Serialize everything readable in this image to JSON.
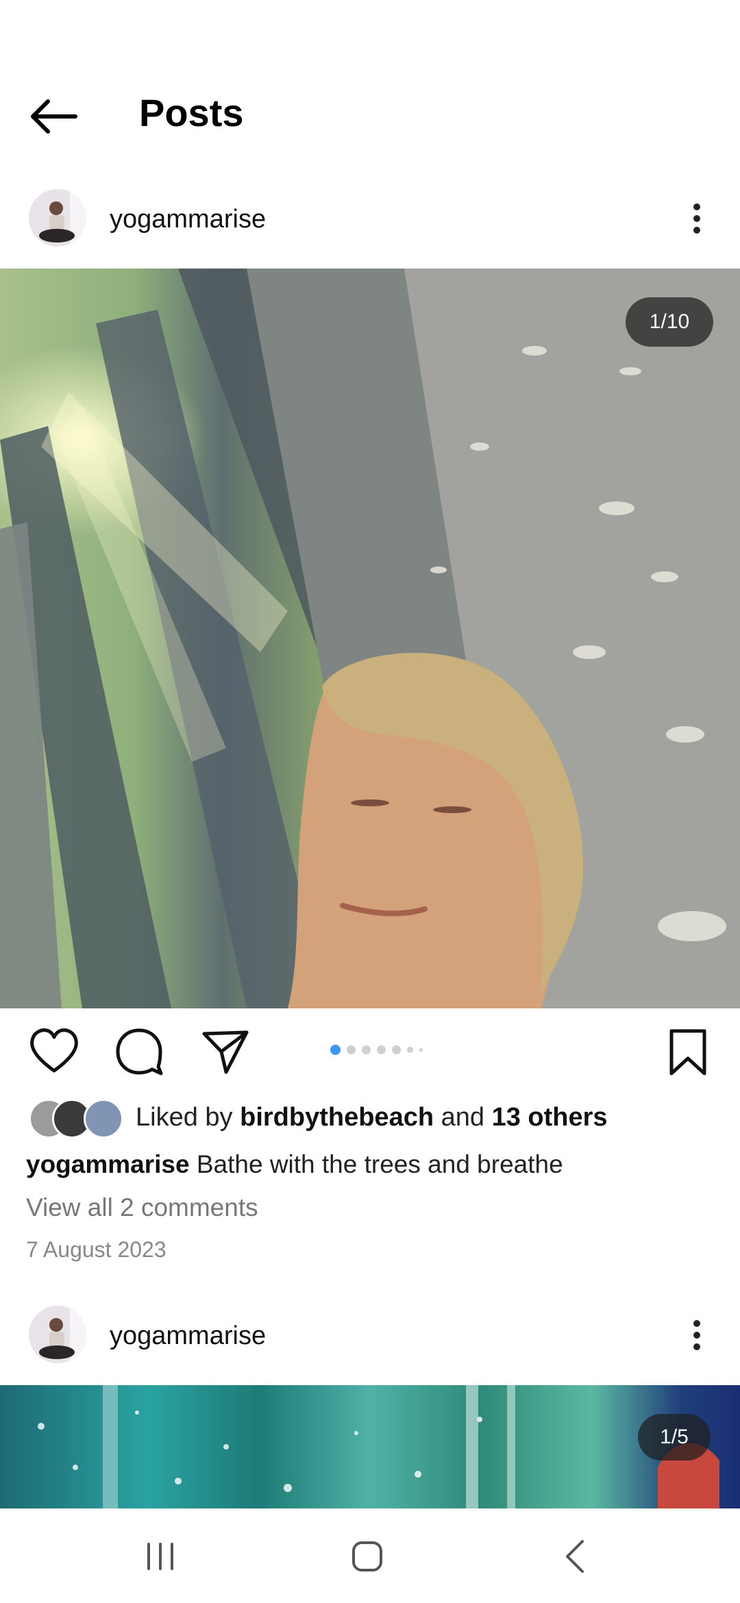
{
  "header": {
    "title": "Posts"
  },
  "posts": [
    {
      "username": "yogammarise",
      "counter": "1/10",
      "liked_by_prefix": "Liked by",
      "liked_by_user": "birdbythebeach",
      "liked_by_and": "and",
      "liked_by_others": "13 others",
      "caption_user": "yogammarise",
      "caption_text": " Bathe with the trees and breathe",
      "view_comments": "View all 2 comments",
      "date": "7 August 2023",
      "carousel_position": 1,
      "carousel_total": 10
    },
    {
      "username": "yogammarise",
      "counter": "1/5"
    }
  ],
  "colors": {
    "accent_dot": "#3897f0",
    "inactive_dot": "#cfcfcf",
    "text_primary": "#111111",
    "text_secondary": "#777777"
  },
  "icons": [
    "back-arrow-icon",
    "more-options-icon",
    "heart-icon",
    "comment-icon",
    "share-icon",
    "bookmark-icon",
    "recents-icon",
    "home-icon",
    "nav-back-icon"
  ]
}
